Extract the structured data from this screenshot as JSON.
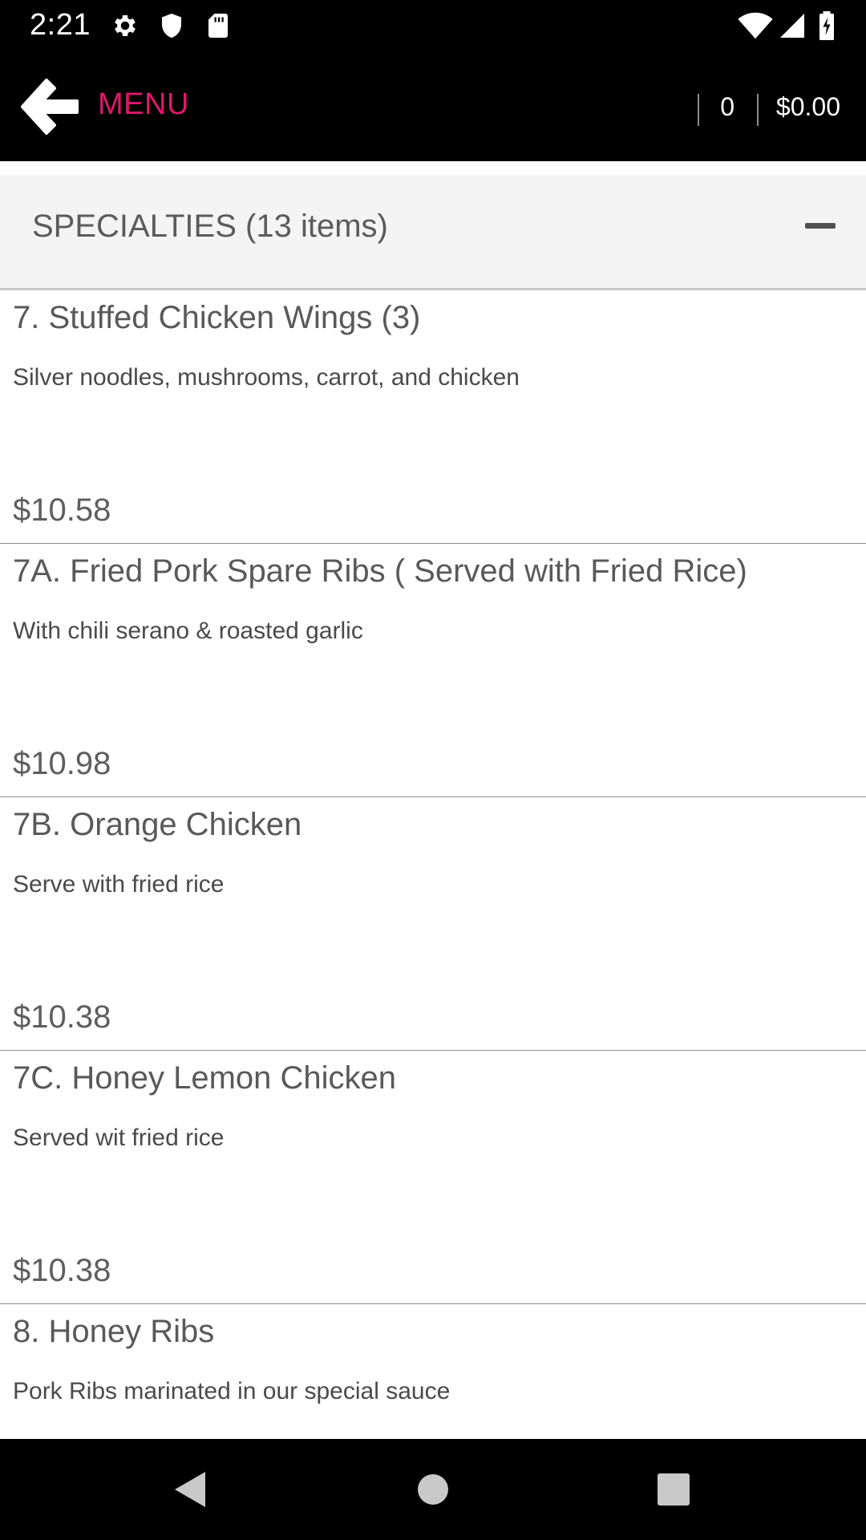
{
  "status_bar": {
    "time": "2:21",
    "icons": [
      "settings-icon",
      "shield-icon",
      "sd-card-icon",
      "wifi-icon",
      "signal-icon",
      "battery-charging-icon"
    ]
  },
  "header": {
    "back_icon": "back-arrow-icon",
    "title": "MENU",
    "cart_count": "0",
    "cart_total": "$0.00",
    "title_color": "#e0176b"
  },
  "category": {
    "title": "SPECIALTIES (13 items)",
    "toggle_icon": "minus-icon"
  },
  "items": [
    {
      "name": "7. Stuffed Chicken Wings (3)",
      "description": "Silver noodles, mushrooms, carrot, and chicken",
      "price": "$10.58"
    },
    {
      "name": "7A. Fried Pork Spare Ribs ( Served with Fried Rice)",
      "description": "With chili serano & roasted garlic",
      "price": "$10.98"
    },
    {
      "name": "7B. Orange Chicken",
      "description": "Serve with fried rice",
      "price": "$10.38"
    },
    {
      "name": "7C. Honey Lemon Chicken",
      "description": "Served wit fried rice",
      "price": "$10.38"
    },
    {
      "name": "8. Honey Ribs",
      "description": "Pork Ribs marinated in our special sauce",
      "price": ""
    }
  ],
  "nav_bar": {
    "icons": [
      "back-triangle-icon",
      "home-circle-icon",
      "recents-square-icon"
    ]
  }
}
